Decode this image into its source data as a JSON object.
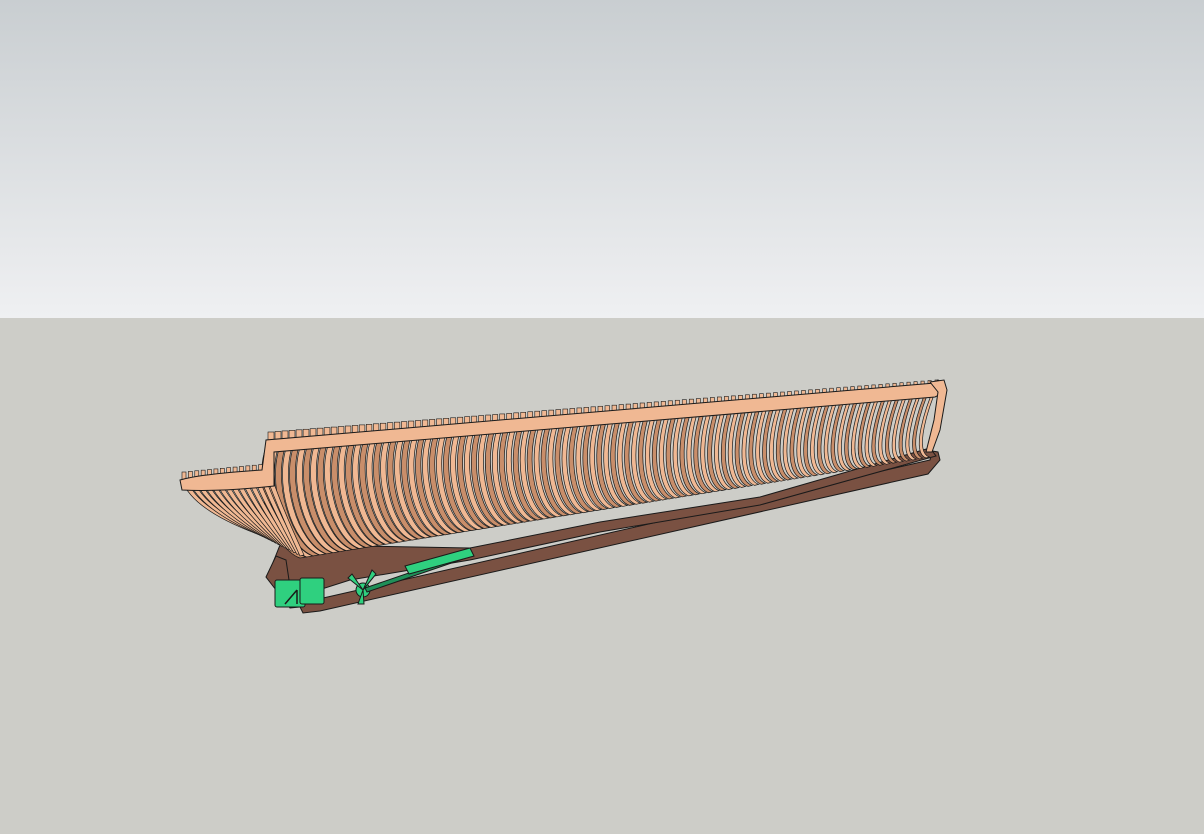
{
  "scene": {
    "sky_top_color": "#c9ced1",
    "sky_bottom_color": "#eff0f2",
    "ground_color": "#cdcdc8"
  },
  "model": {
    "frame_color": "#f0b893",
    "frame_shadow_color": "#c98e6a",
    "keel_color": "#7a5142",
    "edge_color": "#1a1a1a",
    "hardware_color": "#2fd07f",
    "frame_count": 96
  }
}
